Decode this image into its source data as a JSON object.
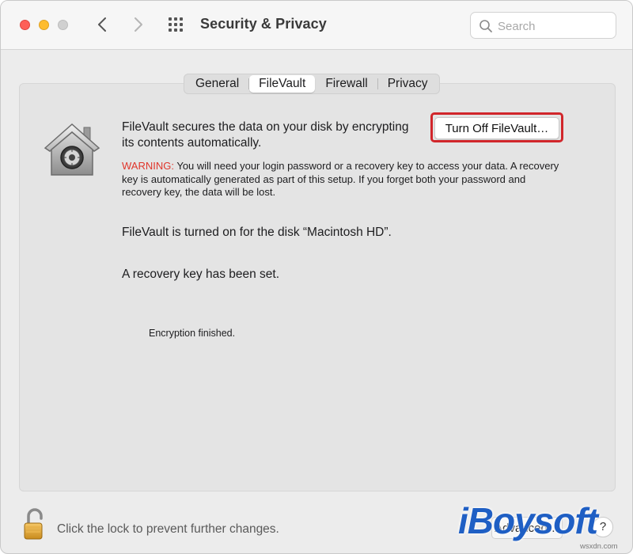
{
  "window": {
    "title": "Security & Privacy"
  },
  "toolbar": {
    "back_icon": "chevron-left-icon",
    "forward_icon": "chevron-right-icon",
    "grid_icon": "grid-icon"
  },
  "search": {
    "placeholder": "Search",
    "value": ""
  },
  "tabs": [
    {
      "label": "General",
      "active": false
    },
    {
      "label": "FileVault",
      "active": true
    },
    {
      "label": "Firewall",
      "active": false
    },
    {
      "label": "Privacy",
      "active": false
    }
  ],
  "filevault": {
    "description": "FileVault secures the data on your disk by encrypting its contents automatically.",
    "warning_label": "WARNING:",
    "warning_text": " You will need your login password or a recovery key to access your data. A recovery key is automatically generated as part of this setup. If you forget both your password and recovery key, the data will be lost.",
    "turn_off_button": "Turn Off FileVault…",
    "status_disk": "FileVault is turned on for the disk “Macintosh HD”.",
    "status_key": "A recovery key has been set.",
    "encryption_status": "Encryption finished."
  },
  "footer": {
    "lock_text": "Click the lock to prevent further changes.",
    "advanced_button": "Advanced…",
    "help_button": "?"
  },
  "watermark": {
    "logo": "iBoysoft",
    "site": "wsxdn.com"
  },
  "colors": {
    "warning_red": "#e0352b",
    "highlight_red": "#d1262b",
    "close_red": "#fe5f57",
    "minimize_yellow": "#febc2e",
    "brand_blue": "#1f5fc4"
  }
}
